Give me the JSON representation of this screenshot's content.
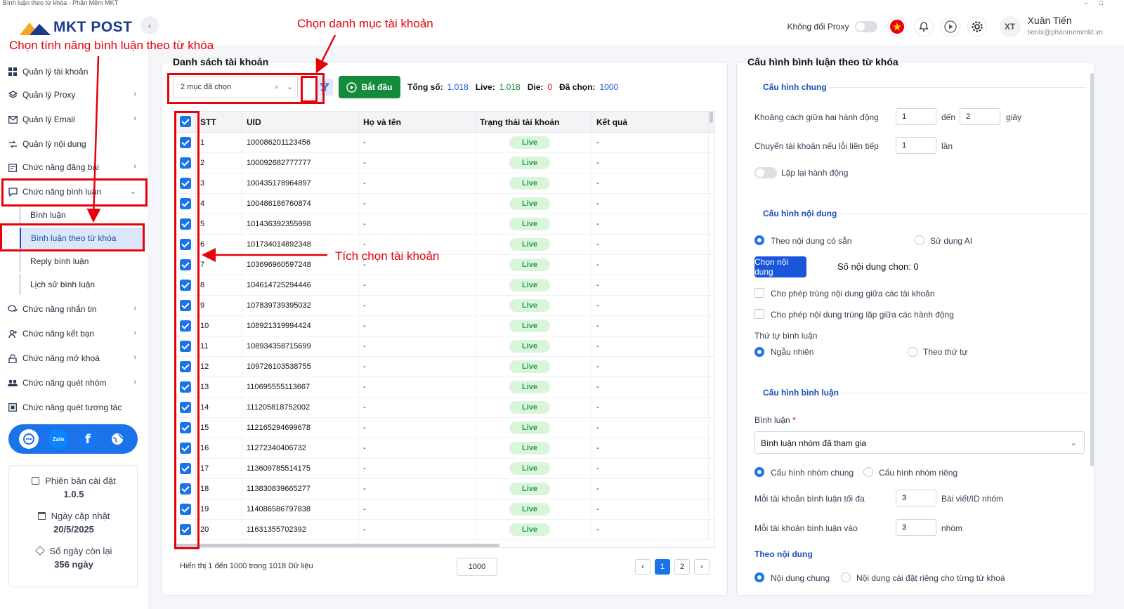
{
  "window": {
    "title": "Bình luận theo từ khóa - Phần Mềm MKT"
  },
  "header": {
    "logo_text": "MKT POST",
    "proxy_label": "Không đổi Proxy",
    "user_initials": "XT",
    "user_name": "Xuân Tiến",
    "user_email": "tienlx@phanmemmkt.vn"
  },
  "sidebar": {
    "items": [
      {
        "label": "Quản lý tài khoản",
        "icon": "grid-icon"
      },
      {
        "label": "Quản lý Proxy",
        "icon": "layers-icon"
      },
      {
        "label": "Quản lý Email",
        "icon": "mail-icon"
      },
      {
        "label": "Quản lý nội dung",
        "icon": "content-icon"
      },
      {
        "label": "Chức năng đăng bài",
        "icon": "post-icon"
      },
      {
        "label": "Chức năng bình luận",
        "icon": "comment-icon"
      },
      {
        "label": "Chức năng nhắn tin",
        "icon": "chat-icon"
      },
      {
        "label": "Chức năng kết bạn",
        "icon": "add-friend-icon"
      },
      {
        "label": "Chức năng mở khoá",
        "icon": "unlock-icon"
      },
      {
        "label": "Chức năng quét nhóm",
        "icon": "group-icon"
      },
      {
        "label": "Chức năng quét tương tác",
        "icon": "scan-icon"
      }
    ],
    "sub_items": [
      "Bình luận",
      "Bình luận theo từ khóa",
      "Reply bình luận",
      "Lịch sử bình luận"
    ],
    "info": {
      "version_label": "Phiên bản cài đặt",
      "version": "1.0.5",
      "update_label": "Ngày cập nhật",
      "update_date": "20/5/2025",
      "remaining_label": "Số ngày còn lại",
      "remaining": "356 ngày"
    }
  },
  "accounts": {
    "title": "Danh sách tài khoản",
    "category_value": "2 mục đã chọn",
    "start_label": "Bắt đầu",
    "stats": [
      {
        "label": "Tổng số:",
        "value": "1.018",
        "color": "#1a56db"
      },
      {
        "label": "Live:",
        "value": "1.018",
        "color": "#148a3b"
      },
      {
        "label": "Die:",
        "value": "0",
        "color": "#e8000b"
      },
      {
        "label": "Đã chọn:",
        "value": "1000",
        "color": "#1a56db"
      }
    ],
    "columns": [
      "STT",
      "UID",
      "Họ và tên",
      "Trạng thái tài khoản",
      "Kết quả"
    ],
    "rows": [
      {
        "stt": "1",
        "uid": "100086201123456",
        "name": "-",
        "status": "Live",
        "result": "-"
      },
      {
        "stt": "2",
        "uid": "100092682777777",
        "name": "-",
        "status": "Live",
        "result": "-"
      },
      {
        "stt": "3",
        "uid": "100435178964897",
        "name": "-",
        "status": "Live",
        "result": "-"
      },
      {
        "stt": "4",
        "uid": "100486186760874",
        "name": "-",
        "status": "Live",
        "result": "-"
      },
      {
        "stt": "5",
        "uid": "101436392355998",
        "name": "-",
        "status": "Live",
        "result": "-"
      },
      {
        "stt": "6",
        "uid": "101734014892348",
        "name": "-",
        "status": "Live",
        "result": "-"
      },
      {
        "stt": "7",
        "uid": "103696960597248",
        "name": "-",
        "status": "Live",
        "result": "-"
      },
      {
        "stt": "8",
        "uid": "104614725294446",
        "name": "-",
        "status": "Live",
        "result": "-"
      },
      {
        "stt": "9",
        "uid": "107839739395032",
        "name": "-",
        "status": "Live",
        "result": "-"
      },
      {
        "stt": "10",
        "uid": "108921319994424",
        "name": "-",
        "status": "Live",
        "result": "-"
      },
      {
        "stt": "11",
        "uid": "108934358715699",
        "name": "-",
        "status": "Live",
        "result": "-"
      },
      {
        "stt": "12",
        "uid": "109726103538755",
        "name": "-",
        "status": "Live",
        "result": "-"
      },
      {
        "stt": "13",
        "uid": "110695555113667",
        "name": "-",
        "status": "Live",
        "result": "-"
      },
      {
        "stt": "14",
        "uid": "111205818752002",
        "name": "-",
        "status": "Live",
        "result": "-"
      },
      {
        "stt": "15",
        "uid": "112165294699678",
        "name": "-",
        "status": "Live",
        "result": "-"
      },
      {
        "stt": "16",
        "uid": "11272340406732",
        "name": "-",
        "status": "Live",
        "result": "-"
      },
      {
        "stt": "17",
        "uid": "113609785514175",
        "name": "-",
        "status": "Live",
        "result": "-"
      },
      {
        "stt": "18",
        "uid": "113830839665277",
        "name": "-",
        "status": "Live",
        "result": "-"
      },
      {
        "stt": "19",
        "uid": "114086586797838",
        "name": "-",
        "status": "Live",
        "result": "-"
      },
      {
        "stt": "20",
        "uid": "11631355702392",
        "name": "-",
        "status": "Live",
        "result": "-"
      }
    ],
    "footer_text": "Hiển thị 1 đến 1000 trong 1018 Dữ liệu",
    "page_size": "1000",
    "pages": [
      "1",
      "2"
    ]
  },
  "config": {
    "title": "Cấu hình bình luận theo từ khóa",
    "general": {
      "heading": "Cấu hình chung",
      "interval_label": "Khoảng cách giữa hai hành động",
      "interval_from": "1",
      "to_label": "đến",
      "interval_to": "2",
      "unit_sec": "giây",
      "switch_label": "Chuyển tài khoản nếu lỗi liên tiếp",
      "switch_value": "1",
      "unit_times": "lần",
      "repeat_label": "Lặp lại hành động"
    },
    "content": {
      "heading": "Cấu hình nội dung",
      "opt_existing": "Theo nội dung có sẵn",
      "opt_ai": "Sử dụng AI",
      "choose_btn": "Chọn nội dung",
      "chosen_count": "Số nội dung chọn: 0",
      "chk1": "Cho phép trùng nội dung giữa các tài khoản",
      "chk2": "Cho phép nội dung trùng lặp giữa các hành động",
      "order_label": "Thứ tự bình luận",
      "order_random": "Ngẫu nhiên",
      "order_seq": "Theo thứ tự"
    },
    "comment": {
      "heading": "Cấu hình bình luận",
      "comment_label": "Bình luận",
      "required": "*",
      "comment_value": "Bình luận nhóm đã tham gia",
      "opt_common": "Cấu hình nhóm chung",
      "opt_private": "Cấu hình nhóm riêng",
      "max_label": "Mỗi tài khoản bình luận tối đa",
      "max_value": "3",
      "max_unit": "Bài viết/ID nhóm",
      "into_label": "Mỗi tài khoản bình luận vào",
      "into_value": "3",
      "into_unit": "nhóm",
      "by_content": "Theo nội dung",
      "opt_common_content": "Nội dung chung",
      "opt_private_content": "Nội dung cài đặt riêng cho từng từ khoá"
    }
  },
  "annotations": {
    "select_category": "Chọn danh mục tài khoản",
    "select_feature": "Chọn tính năng bình luận theo từ khóa",
    "tick_accounts": "Tích chọn tài khoản"
  },
  "colors": {
    "accent": "#1a73e8",
    "highlight": "#e8000b",
    "live_bg": "#d9f5dc",
    "live_fg": "#2e9e3f",
    "start_btn": "#148a3b"
  }
}
